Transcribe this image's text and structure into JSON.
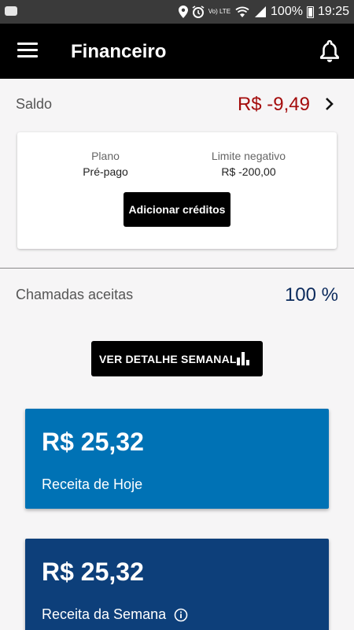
{
  "status_bar": {
    "time": "19:25",
    "battery": "100%",
    "volte": "Vo) LTE"
  },
  "app_bar": {
    "title": "Financeiro"
  },
  "saldo": {
    "label": "Saldo",
    "value": "R$ -9,49"
  },
  "plan_card": {
    "plan_label": "Plano",
    "plan_value": "Pré-pago",
    "limit_label": "Limite negativo",
    "limit_value": "R$ -200,00",
    "add_credits_label": "Adicionar créditos"
  },
  "chamadas": {
    "label": "Chamadas aceitas",
    "value": "100 %"
  },
  "weekly_button": {
    "label": "VER DETALHE SEMANAL"
  },
  "revenue": {
    "today": {
      "amount": "R$ 25,32",
      "label": "Receita de Hoje"
    },
    "week": {
      "amount": "R$ 25,32",
      "label": "Receita da Semana"
    }
  },
  "colors": {
    "negative": "#a40c0c",
    "accent_dark": "#0b2a5c",
    "card_today": "#0072b5",
    "card_week": "#0d3f7a"
  }
}
